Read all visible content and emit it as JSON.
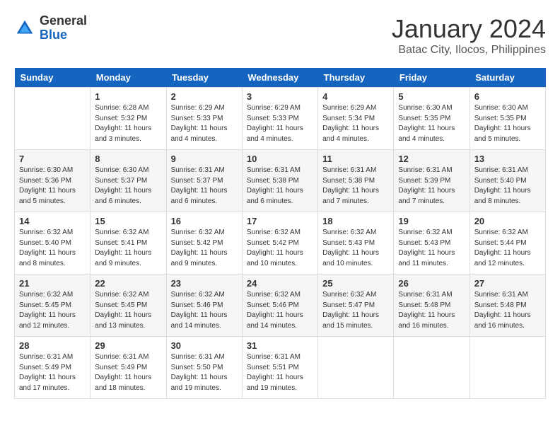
{
  "header": {
    "logo_general": "General",
    "logo_blue": "Blue",
    "month_year": "January 2024",
    "location": "Batac City, Ilocos, Philippines"
  },
  "days_of_week": [
    "Sunday",
    "Monday",
    "Tuesday",
    "Wednesday",
    "Thursday",
    "Friday",
    "Saturday"
  ],
  "weeks": [
    [
      {
        "day": "",
        "empty": true
      },
      {
        "day": "1",
        "sunrise": "6:28 AM",
        "sunset": "5:32 PM",
        "daylight": "11 hours and 3 minutes."
      },
      {
        "day": "2",
        "sunrise": "6:29 AM",
        "sunset": "5:33 PM",
        "daylight": "11 hours and 4 minutes."
      },
      {
        "day": "3",
        "sunrise": "6:29 AM",
        "sunset": "5:33 PM",
        "daylight": "11 hours and 4 minutes."
      },
      {
        "day": "4",
        "sunrise": "6:29 AM",
        "sunset": "5:34 PM",
        "daylight": "11 hours and 4 minutes."
      },
      {
        "day": "5",
        "sunrise": "6:30 AM",
        "sunset": "5:35 PM",
        "daylight": "11 hours and 4 minutes."
      },
      {
        "day": "6",
        "sunrise": "6:30 AM",
        "sunset": "5:35 PM",
        "daylight": "11 hours and 5 minutes."
      }
    ],
    [
      {
        "day": "7",
        "sunrise": "6:30 AM",
        "sunset": "5:36 PM",
        "daylight": "11 hours and 5 minutes."
      },
      {
        "day": "8",
        "sunrise": "6:30 AM",
        "sunset": "5:37 PM",
        "daylight": "11 hours and 6 minutes."
      },
      {
        "day": "9",
        "sunrise": "6:31 AM",
        "sunset": "5:37 PM",
        "daylight": "11 hours and 6 minutes."
      },
      {
        "day": "10",
        "sunrise": "6:31 AM",
        "sunset": "5:38 PM",
        "daylight": "11 hours and 6 minutes."
      },
      {
        "day": "11",
        "sunrise": "6:31 AM",
        "sunset": "5:38 PM",
        "daylight": "11 hours and 7 minutes."
      },
      {
        "day": "12",
        "sunrise": "6:31 AM",
        "sunset": "5:39 PM",
        "daylight": "11 hours and 7 minutes."
      },
      {
        "day": "13",
        "sunrise": "6:31 AM",
        "sunset": "5:40 PM",
        "daylight": "11 hours and 8 minutes."
      }
    ],
    [
      {
        "day": "14",
        "sunrise": "6:32 AM",
        "sunset": "5:40 PM",
        "daylight": "11 hours and 8 minutes."
      },
      {
        "day": "15",
        "sunrise": "6:32 AM",
        "sunset": "5:41 PM",
        "daylight": "11 hours and 9 minutes."
      },
      {
        "day": "16",
        "sunrise": "6:32 AM",
        "sunset": "5:42 PM",
        "daylight": "11 hours and 9 minutes."
      },
      {
        "day": "17",
        "sunrise": "6:32 AM",
        "sunset": "5:42 PM",
        "daylight": "11 hours and 10 minutes."
      },
      {
        "day": "18",
        "sunrise": "6:32 AM",
        "sunset": "5:43 PM",
        "daylight": "11 hours and 10 minutes."
      },
      {
        "day": "19",
        "sunrise": "6:32 AM",
        "sunset": "5:43 PM",
        "daylight": "11 hours and 11 minutes."
      },
      {
        "day": "20",
        "sunrise": "6:32 AM",
        "sunset": "5:44 PM",
        "daylight": "11 hours and 12 minutes."
      }
    ],
    [
      {
        "day": "21",
        "sunrise": "6:32 AM",
        "sunset": "5:45 PM",
        "daylight": "11 hours and 12 minutes."
      },
      {
        "day": "22",
        "sunrise": "6:32 AM",
        "sunset": "5:45 PM",
        "daylight": "11 hours and 13 minutes."
      },
      {
        "day": "23",
        "sunrise": "6:32 AM",
        "sunset": "5:46 PM",
        "daylight": "11 hours and 14 minutes."
      },
      {
        "day": "24",
        "sunrise": "6:32 AM",
        "sunset": "5:46 PM",
        "daylight": "11 hours and 14 minutes."
      },
      {
        "day": "25",
        "sunrise": "6:32 AM",
        "sunset": "5:47 PM",
        "daylight": "11 hours and 15 minutes."
      },
      {
        "day": "26",
        "sunrise": "6:31 AM",
        "sunset": "5:48 PM",
        "daylight": "11 hours and 16 minutes."
      },
      {
        "day": "27",
        "sunrise": "6:31 AM",
        "sunset": "5:48 PM",
        "daylight": "11 hours and 16 minutes."
      }
    ],
    [
      {
        "day": "28",
        "sunrise": "6:31 AM",
        "sunset": "5:49 PM",
        "daylight": "11 hours and 17 minutes."
      },
      {
        "day": "29",
        "sunrise": "6:31 AM",
        "sunset": "5:49 PM",
        "daylight": "11 hours and 18 minutes."
      },
      {
        "day": "30",
        "sunrise": "6:31 AM",
        "sunset": "5:50 PM",
        "daylight": "11 hours and 19 minutes."
      },
      {
        "day": "31",
        "sunrise": "6:31 AM",
        "sunset": "5:51 PM",
        "daylight": "11 hours and 19 minutes."
      },
      {
        "day": "",
        "empty": true
      },
      {
        "day": "",
        "empty": true
      },
      {
        "day": "",
        "empty": true
      }
    ]
  ],
  "labels": {
    "sunrise_prefix": "Sunrise: ",
    "sunset_prefix": "Sunset: ",
    "daylight_prefix": "Daylight: "
  }
}
